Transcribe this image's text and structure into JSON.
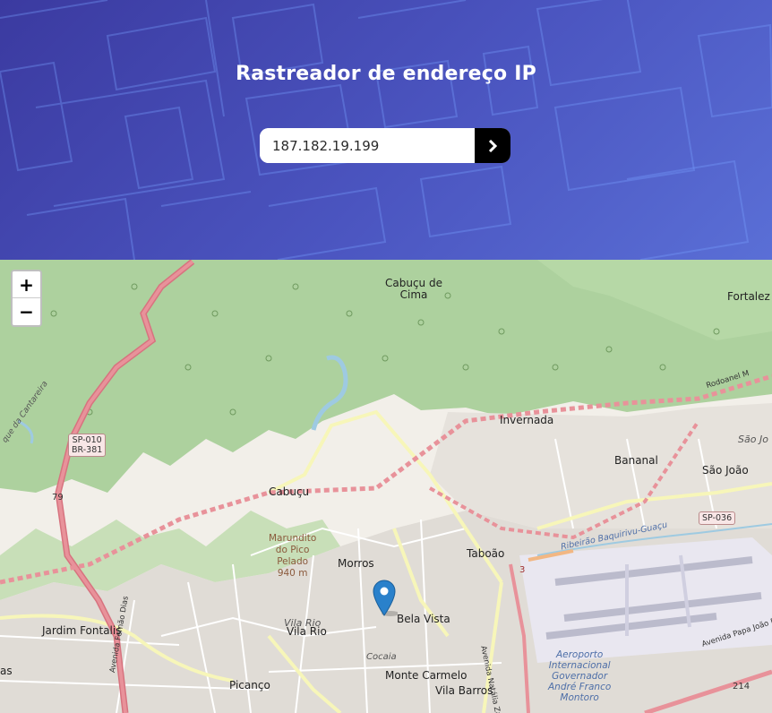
{
  "header": {
    "title": "Rastreador de endereço IP",
    "search": {
      "value": "187.182.19.199",
      "submit_icon": "chevron-right-icon"
    }
  },
  "map": {
    "zoom": {
      "in_label": "+",
      "out_label": "−"
    },
    "marker_icon": "map-pin-icon",
    "places": {
      "cabucu_de_cima": "Cabuçu de\nCima",
      "fortalez": "Fortalez",
      "invernada": "Invernada",
      "bananal": "Bananal",
      "sao_joao": "São João",
      "sao_jo_italic": "São Jo",
      "cabucu": "Cabuçu",
      "taboao": "Taboão",
      "morros": "Morros",
      "bela_vista": "Bela Vista",
      "jardim_fontalis": "Jardim Fontalis",
      "vila_rio_italic": "Vila Rio",
      "vila_rio": "Vila Rio",
      "cocaia": "Cocaia",
      "monte_carmelo": "Monte Carmelo",
      "vila_barros": "Vila Barros",
      "picanco": "Picanço",
      "as": "as",
      "marundito": "Marundito\ndo Pico\nPelado\n940 m",
      "aeroporto": "Aeroporto\nInternacional\nGovernador\nAndré Franco\nMontoro",
      "ribeirao": "Ribeirão Baquirivu-Guaçu",
      "rodoanel": "Rodoanel M",
      "que_da_cantareira": "que da Cantareira",
      "av_natalia": "Avenida Natália Zarif",
      "av_papa": "Avenida Papa João Pa",
      "av_fernao": "Avenida Fernão Dias"
    },
    "shields": {
      "sp010": "SP-010\nBR-381",
      "sp036": "SP-036",
      "r79": "79",
      "r3": "3",
      "r214": "214"
    }
  }
}
